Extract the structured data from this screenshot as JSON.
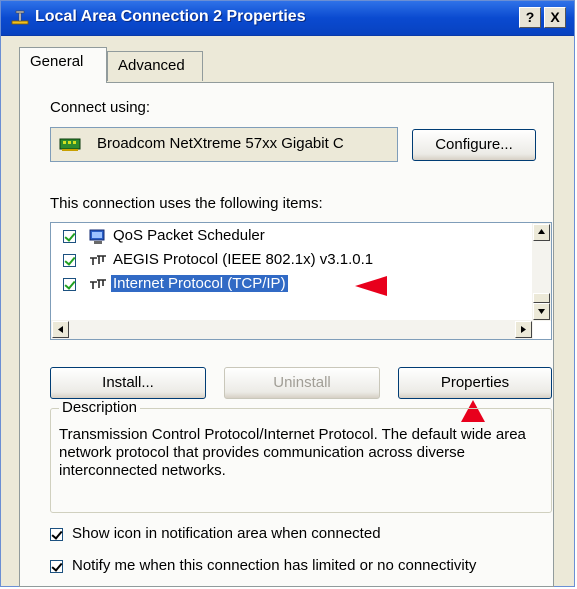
{
  "window": {
    "title": "Local Area Connection 2 Properties",
    "help_button": "?",
    "close_button": "X"
  },
  "tabs": [
    {
      "label": "General",
      "active": true
    },
    {
      "label": "Advanced",
      "active": false
    }
  ],
  "connect_using": {
    "label": "Connect using:",
    "adapter_name": "Broadcom NetXtreme 57xx Gigabit C",
    "configure_button": "Configure..."
  },
  "items_section": {
    "label": "This connection uses the following items:",
    "items": [
      {
        "label": "QoS Packet Scheduler",
        "checked": true,
        "selected": false,
        "icon": "scheduler-icon"
      },
      {
        "label": "AEGIS Protocol (IEEE 802.1x) v3.1.0.1",
        "checked": true,
        "selected": false,
        "icon": "protocol-icon"
      },
      {
        "label": "Internet Protocol (TCP/IP)",
        "checked": true,
        "selected": true,
        "icon": "protocol-icon"
      }
    ]
  },
  "buttons": {
    "install": "Install...",
    "uninstall": "Uninstall",
    "properties": "Properties"
  },
  "description": {
    "legend": "Description",
    "text": "Transmission Control Protocol/Internet Protocol. The default wide area network protocol that provides communication across diverse interconnected networks."
  },
  "options": [
    {
      "label": "Show icon in notification area when connected",
      "checked": true
    },
    {
      "label": "Notify me when this connection has limited or no connectivity",
      "checked": true
    }
  ],
  "colors": {
    "titlebar": "#0a4ad0",
    "selection": "#316ac5",
    "annotation_arrow": "#e8001c"
  }
}
